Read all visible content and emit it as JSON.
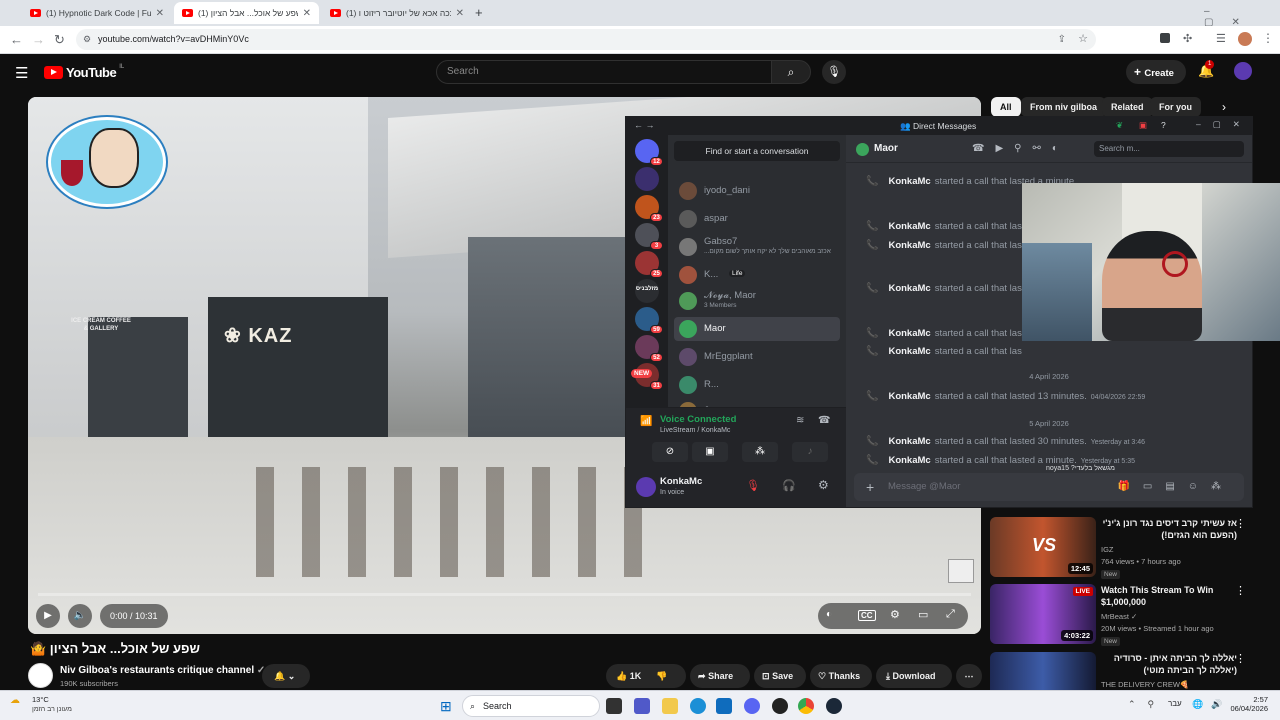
{
  "browser": {
    "tabs": [
      {
        "title": "(1) Hypnotic Dark Code | Futuri",
        "active": false
      },
      {
        "title": "(1) שפע של אוכל... אבל הציון 🤷",
        "active": true
      },
      {
        "title": "(1) ככה אכא של יוטיובר ריזוט ו",
        "active": false
      }
    ],
    "url": "youtube.com/watch?v=avDHMinY0Vc"
  },
  "youtube": {
    "logo": "YouTube",
    "country": "IL",
    "search_placeholder": "Search",
    "create_label": "Create",
    "notif_count": "1",
    "video": {
      "time": "0:00 / 10:31",
      "sign_left": "ICE CREAM COFFEE & GALLERY",
      "sign_kaz": "KAZ"
    },
    "title": "שפע של אוכל... אבל הציון 🤷",
    "channel": "Niv Gilboa's restaurants critique channel",
    "subscribers": "190K subscribers",
    "likes": "1K",
    "share": "Share",
    "save": "Save",
    "thanks": "Thanks",
    "download": "Download",
    "chips": [
      "All",
      "From niv gilboa",
      "Related",
      "For you"
    ],
    "recommendations": [
      {
        "title": "אז עשיתי קרב דיסים נגד רונן ג'ינ'י (הפעם הוא הגזים!)",
        "channel": "IGZ",
        "meta": "764 views • 7 hours ago",
        "badge": "New",
        "duration": "12:45",
        "color": "#7a3f2a"
      },
      {
        "title": "Watch This Stream To Win $1,000,000",
        "channel": "MrBeast",
        "meta": "20M views • Streamed 1 hour ago",
        "badge": "New",
        "duration": "4:03:22",
        "live": "LIVE",
        "color": "#5a2a8a"
      },
      {
        "title": "יאללה לך הביתה איתן - סרודיה (יאללה לך הביתה מוטי)",
        "channel": "THE DELIVERY CREW🍕",
        "meta": "",
        "badge": "",
        "duration": "",
        "color": "#2a3a6a"
      }
    ]
  },
  "discord": {
    "title": "Direct Messages",
    "find_placeholder": "Find or start a conversation",
    "channel_name": "Maor",
    "search_placeholder": "Search m...",
    "servers": [
      {
        "badge": "12",
        "color": "#5865f2"
      },
      {
        "badge": "",
        "color": "#3b2f6e"
      },
      {
        "badge": "23",
        "color": "#c0541c"
      },
      {
        "badge": "3",
        "color": "#4e5058"
      },
      {
        "badge": "25",
        "color": "#9b3434"
      },
      {
        "badge": "",
        "label": "מזלבניס",
        "color": "#2b2d31"
      },
      {
        "badge": "59",
        "color": "#2b5c8a"
      },
      {
        "badge": "52",
        "color": "#6b3a5a"
      },
      {
        "badge": "31",
        "label": "NEW",
        "color": "#7b2d2d"
      }
    ],
    "dms": [
      {
        "name": "iyodo_dani",
        "sub": "",
        "color": "#6b4b3a"
      },
      {
        "name": "aspar",
        "sub": "",
        "color": "#5a5a5a"
      },
      {
        "name": "Gabso7",
        "sub": "...אכזב מאוהבים שלך לא יקח אותך לשום מקום",
        "color": "#777"
      },
      {
        "name": "K...",
        "sub": "",
        "tag": "Life",
        "color": "#a0523d"
      },
      {
        "name": "𝓝𝓸𝔂𝓪, Maor",
        "sub": "3 Members",
        "color": "#4f9a58"
      },
      {
        "name": "Maor",
        "sub": "",
        "color": "#3ba55c"
      },
      {
        "name": "MrEggplant",
        "sub": "",
        "color": "#5d4a6a"
      },
      {
        "name": "R...",
        "sub": "",
        "color": "#3a8a6a"
      },
      {
        "name": "J...",
        "sub": "",
        "color": "#8a6a3a"
      }
    ],
    "voice": {
      "status": "Voice Connected",
      "detail": "LiveStream / KonkaMc"
    },
    "user": {
      "name": "KonkaMc",
      "status": "In voice"
    },
    "messages": [
      {
        "user": "KonkaMc",
        "text": "started a call that lasted a minute.",
        "ts": ""
      },
      {
        "user": "KonkaMc",
        "text": "started a call that las",
        "ts": ""
      },
      {
        "user": "KonkaMc",
        "text": "started a call that las",
        "ts": ""
      },
      {
        "user": "KonkaMc",
        "text": "started a call that las",
        "ts": ""
      },
      {
        "user": "KonkaMc",
        "text": "started a call that las",
        "ts": ""
      },
      {
        "user": "KonkaMc",
        "text": "started a call that las",
        "ts": ""
      },
      {
        "user": "KonkaMc",
        "text": "started a call that lasted 13 minutes.",
        "ts": "04/04/2026 22:59"
      },
      {
        "user": "KonkaMc",
        "text": "started a call that lasted 30 minutes.",
        "ts": "Yesterday at 3:46"
      },
      {
        "user": "KonkaMc",
        "text": "started a call that lasted a minute.",
        "ts": "Yesterday at 5:35"
      }
    ],
    "date_dividers": [
      "4 April 2026",
      "5 April 2026"
    ],
    "typing": "noya15 ?מגשאל בלעדי",
    "message_placeholder": "Message @Maor"
  },
  "taskbar": {
    "weather_temp": "13°C",
    "weather_desc": "מעונן רב הזמן",
    "search_label": "Search",
    "time": "2:57",
    "date": "06/04/2026",
    "lang": "עבר"
  }
}
